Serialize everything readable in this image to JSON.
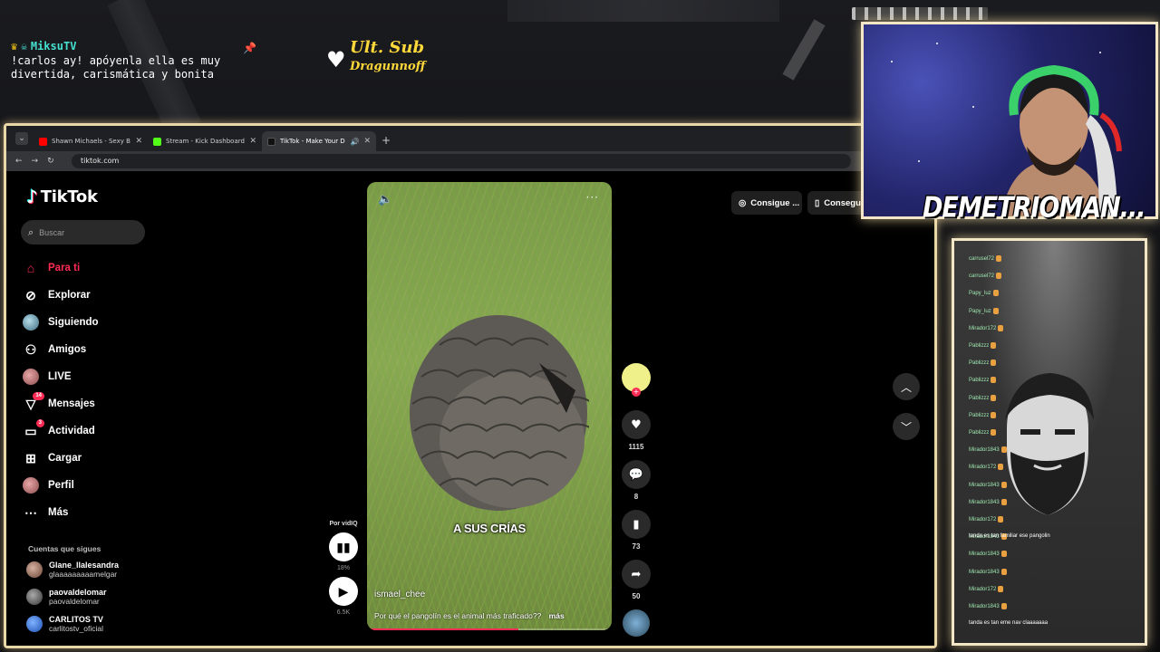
{
  "overlay": {
    "chat_user": "MiksuTV",
    "chat_text": "!carlos ay! apóyenla ella es muy divertida, carismática y bonita",
    "ult_sub_title": "Ult. Sub",
    "ult_sub_name": "Dragunnoff",
    "streamer_name": "DEMETRIOMAN..."
  },
  "browser": {
    "tabs": [
      {
        "label": "Shawn Michaels - Sexy Boy (Cu...",
        "favicon_color": "#ff0000"
      },
      {
        "label": "Stream - Kick Dashboard",
        "favicon_color": "#53fc18"
      },
      {
        "label": "TikTok - Make Your Day",
        "favicon_color": "#000000",
        "active": true
      }
    ],
    "url": "tiktok.com"
  },
  "tiktok": {
    "logo": "TikTok",
    "search_placeholder": "Buscar",
    "nav": [
      {
        "label": "Para ti",
        "icon": "home-icon",
        "active": true
      },
      {
        "label": "Explorar",
        "icon": "compass-icon"
      },
      {
        "label": "Siguiendo",
        "icon": "following-avatar"
      },
      {
        "label": "Amigos",
        "icon": "friends-icon"
      },
      {
        "label": "LIVE",
        "icon": "live-avatar"
      },
      {
        "label": "Mensajes",
        "icon": "messages-icon",
        "badge": "14"
      },
      {
        "label": "Actividad",
        "icon": "activity-icon",
        "badge": "3"
      },
      {
        "label": "Cargar",
        "icon": "upload-icon"
      },
      {
        "label": "Perfil",
        "icon": "profile-avatar"
      },
      {
        "label": "Más",
        "icon": "more-icon"
      }
    ],
    "following_heading": "Cuentas que sigues",
    "following": [
      {
        "name": "Glane_llalesandra",
        "handle": "glaaaaaaaaamelgar"
      },
      {
        "name": "paovaldelomar",
        "handle": "paovaldelomar"
      },
      {
        "name": "CARLITOS TV",
        "handle": "carlitostv_oficial"
      }
    ],
    "video": {
      "overlay_caption": "A SUS CRÍAS",
      "author": "ismael_chee",
      "description": "Por qué el pangolín es el animal más traficado??",
      "more": "más",
      "progress": 0.62
    },
    "actions": {
      "likes": "1115",
      "comments": "8",
      "saves": "73",
      "shares": "50"
    },
    "vidiq": {
      "label": "Por vidIQ",
      "percent": "18%",
      "views": "6.5K"
    },
    "cta_buttons": [
      "Consigue ...",
      "Consegui"
    ]
  },
  "chat_panel": {
    "lines": [
      "carrusel72",
      "carrusel72",
      "Papy_luz",
      "Papy_luz",
      "Mirador172",
      "Pablizzz",
      "Pablizzz",
      "Pablizzz",
      "Pablizzz",
      "Pablizzz",
      "Pablizzz",
      "Mirador1843",
      "Mirador172",
      "Mirador1843",
      "Mirador1843",
      "Mirador172",
      "Mirador1843",
      "Mirador1843",
      "Mirador1843",
      "Mirador172",
      "Mirador1843"
    ],
    "highlight_line_1": "tanda es tan familiar ese pangolin",
    "highlight_line_2": "tanda es tan eme nav claaaaaaa"
  }
}
